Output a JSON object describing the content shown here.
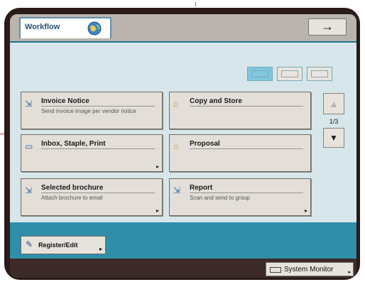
{
  "header": {
    "tab_label": "Workflow",
    "tab_icon": "globe-icon",
    "forward_symbol": "→"
  },
  "view_modes": [
    {
      "name": "view-mode-2col",
      "selected": true
    },
    {
      "name": "view-mode-3col",
      "selected": false
    },
    {
      "name": "view-mode-list",
      "selected": false
    }
  ],
  "cards": [
    {
      "title": "Invoice Notice",
      "desc": "Send invoice image per vendor notice",
      "icon": "scanner-icon"
    },
    {
      "title": "Copy and Store",
      "desc": "",
      "icon": "box-icon"
    },
    {
      "title": "Inbox, Staple, Print",
      "desc": "",
      "icon": "print-icon"
    },
    {
      "title": "Proposal",
      "desc": "",
      "icon": "box-icon"
    },
    {
      "title": "Selected brochure",
      "desc": "Attach brochure to email",
      "icon": "scanner-icon"
    },
    {
      "title": "Report",
      "desc": "Scan and send to group",
      "icon": "scanner-icon"
    }
  ],
  "pagination": {
    "page": "1/3",
    "up": "▲",
    "down": "▼"
  },
  "register_button": {
    "label": "Register/Edit",
    "icon": "pen-icon"
  },
  "footer": {
    "system_monitor_label": "System Monitor"
  },
  "colors": {
    "accent": "#2f8eaa",
    "panel": "#d7e6ea",
    "frame": "#2a1a18"
  }
}
